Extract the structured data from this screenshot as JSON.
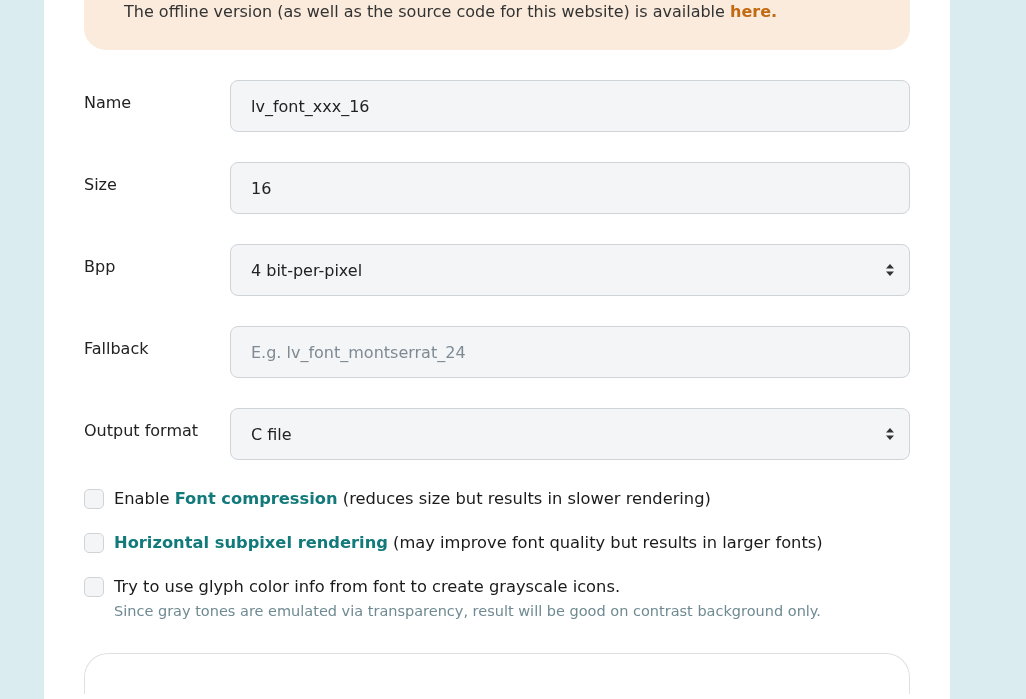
{
  "notice": {
    "text": "The offline version (as well as the source code for this website) is available ",
    "link": "here."
  },
  "fields": [
    {
      "kind": "text",
      "label": "Name",
      "value": "lv_font_xxx_16"
    },
    {
      "kind": "text",
      "label": "Size",
      "value": "16"
    },
    {
      "kind": "select",
      "label": "Bpp",
      "value": "4 bit-per-pixel"
    },
    {
      "kind": "text",
      "label": "Fallback",
      "placeholder": "E.g. lv_font_montserrat_24"
    },
    {
      "kind": "select",
      "label": "Output format",
      "value": "C file"
    }
  ],
  "options": [
    {
      "checked": false,
      "before": "Enable ",
      "link": "Font compression",
      "after": " (reduces size but results in slower rendering)"
    },
    {
      "checked": false,
      "link": "Horizontal subpixel rendering",
      "after": " (may improve font quality but results in larger fonts)"
    },
    {
      "checked": false,
      "before": "Try to use glyph color info from font to create grayscale icons.",
      "hint": "Since gray tones are emulated via transparency, result will be good on contrast background only."
    }
  ]
}
